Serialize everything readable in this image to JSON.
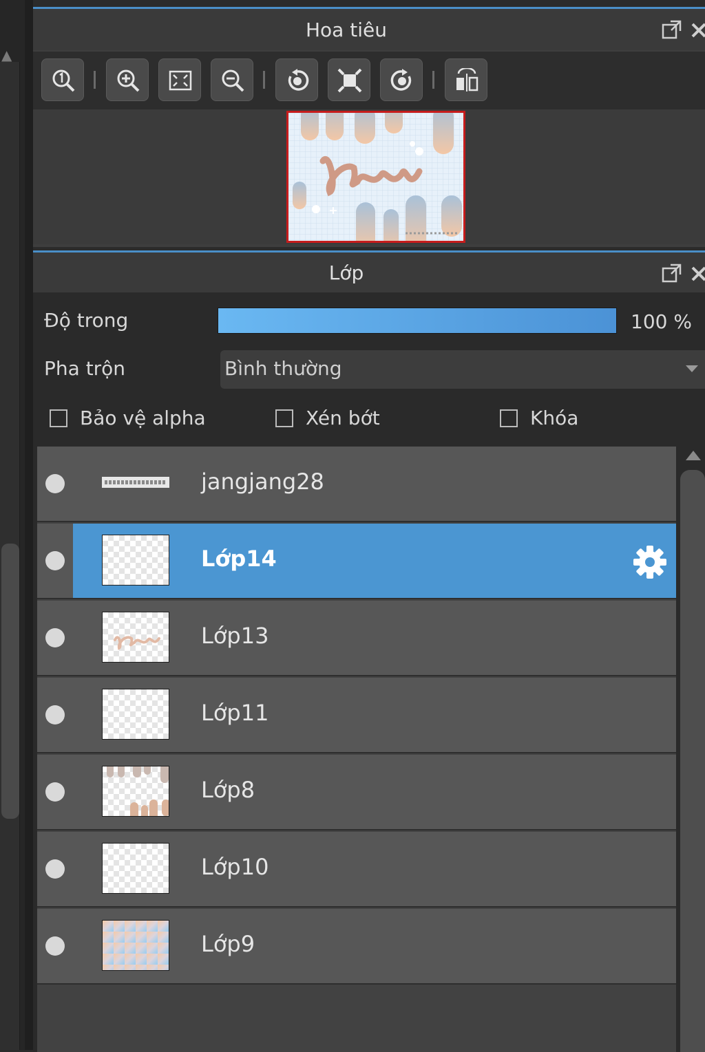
{
  "navigator": {
    "title": "Hoa tiêu",
    "header_icons": [
      "popout-icon",
      "close-icon"
    ],
    "toolbar": [
      "zoom-reset-icon",
      "zoom-in-icon",
      "fit-screen-icon",
      "zoom-out-icon",
      "rotate-left-icon",
      "fit-canvas-icon",
      "rotate-right-icon",
      "flip-horizontal-icon"
    ],
    "preview_border_color": "#c61c1c"
  },
  "layers": {
    "title": "Lớp",
    "opacity_label": "Độ trong",
    "opacity_value": "100 %",
    "opacity_fraction": 1.0,
    "blend_label": "Pha trộn",
    "blend_value": "Bình thường",
    "checks": [
      {
        "label": "Bảo vệ alpha",
        "checked": false
      },
      {
        "label": "Xén bớt",
        "checked": false
      },
      {
        "label": "Khóa",
        "checked": false
      }
    ],
    "items": [
      {
        "name": "jangjang28",
        "selected": false,
        "thumb": "text-strip"
      },
      {
        "name": "Lớp14",
        "selected": true,
        "thumb": "transparent"
      },
      {
        "name": "Lớp13",
        "selected": false,
        "thumb": "script-text"
      },
      {
        "name": "Lớp11",
        "selected": false,
        "thumb": "transparent"
      },
      {
        "name": "Lớp8",
        "selected": false,
        "thumb": "shapes"
      },
      {
        "name": "Lớp10",
        "selected": false,
        "thumb": "transparent"
      },
      {
        "name": "Lớp9",
        "selected": false,
        "thumb": "gradient"
      }
    ]
  },
  "colors": {
    "accent": "#4b96d2",
    "opacity_bar": "#5aa6e6",
    "panel_bg": "#2a2a2a"
  }
}
